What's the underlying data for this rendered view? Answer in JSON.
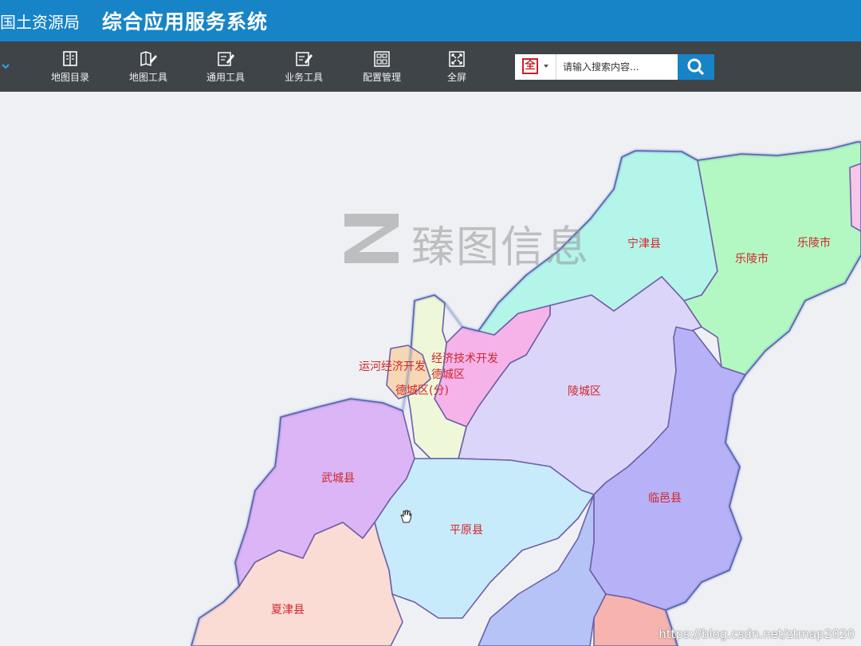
{
  "header": {
    "org": "国土资源局",
    "system_title": "综合应用服务系统",
    "bar_color": "#1784c7"
  },
  "toolbar": {
    "buttons": [
      {
        "label": "地图目录",
        "icon": "book-icon"
      },
      {
        "label": "地图工具",
        "icon": "map-edit-icon"
      },
      {
        "label": "通用工具",
        "icon": "edit-doc-icon"
      },
      {
        "label": "业务工具",
        "icon": "edit-doc-icon"
      },
      {
        "label": "配置管理",
        "icon": "config-icon"
      },
      {
        "label": "全屏",
        "icon": "fullscreen-icon"
      }
    ]
  },
  "search": {
    "scope_glyph": "全",
    "placeholder": "请输入搜索内容...",
    "button_icon": "search-icon"
  },
  "map": {
    "regions": [
      {
        "name": "宁津县",
        "color": "#b3f5e9"
      },
      {
        "name": "乐陵市",
        "color": "#b3f8c2"
      },
      {
        "name": "陵城区",
        "color": "#dcd5fa"
      },
      {
        "name": "运河经济开发区",
        "color": "#f7d8b6"
      },
      {
        "name": "经济技术开发区",
        "color": "#f6b3ea"
      },
      {
        "name": "德城区",
        "color": "#eef8d9"
      },
      {
        "name": "武城县",
        "color": "#dcb5f6"
      },
      {
        "name": "平原县",
        "color": "#c7ebfa"
      },
      {
        "name": "临邑县",
        "color": "#b7b2f7"
      },
      {
        "name": "夏津县",
        "color": "#fadcd5"
      }
    ],
    "labels": {
      "ningjin": "宁津县",
      "laoling_a": "乐陵市",
      "laoling_b": "乐陵市",
      "lingcheng": "陵城区",
      "yunhe": "运河经济开发",
      "jingji": "经济技术开发",
      "decheng_a": "德城区",
      "decheng_b": "德城区(分)",
      "wucheng": "武城县",
      "pingyuan": "平原县",
      "linyi": "临邑县",
      "xiajin": "夏津县"
    }
  },
  "watermark": {
    "text": "臻图信息"
  },
  "credit": "https://blog.csdn.net/ztmap2020"
}
